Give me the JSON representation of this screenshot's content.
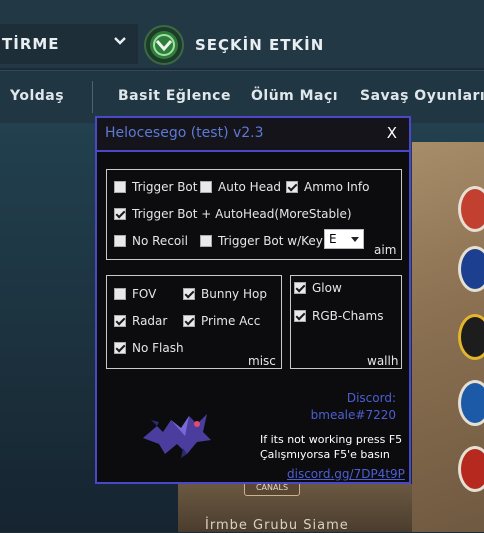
{
  "game": {
    "mode_label": "TİRME",
    "rank_name": "SEÇKİN ETKİN",
    "nav": [
      "Yoldaş",
      "Basit Eğlence",
      "Ölüm Maçı",
      "Savaş Oyunları"
    ],
    "map_tag": "CANALS",
    "bottom_text": "İrmbe Grubu Siame"
  },
  "cheat": {
    "title": "Helocesego (test) v2.3",
    "close": "X",
    "aim_group": {
      "label": "aim",
      "items": [
        {
          "label": "Trigger Bot",
          "checked": false
        },
        {
          "label": "Auto Head",
          "checked": false
        },
        {
          "label": "Ammo Info",
          "checked": true
        },
        {
          "label": "Trigger Bot + AutoHead(MoreStable)",
          "checked": true
        },
        {
          "label": "No Recoil",
          "checked": false
        },
        {
          "label": "Trigger Bot w/Key",
          "checked": false
        }
      ],
      "key_value": "E"
    },
    "misc_group": {
      "label": "misc",
      "items": [
        {
          "label": "FOV",
          "checked": false
        },
        {
          "label": "Bunny Hop",
          "checked": true
        },
        {
          "label": "Radar",
          "checked": true
        },
        {
          "label": "Prime Acc",
          "checked": true
        },
        {
          "label": "No Flash",
          "checked": true
        }
      ]
    },
    "wall_group": {
      "label": "wallh",
      "items": [
        {
          "label": "Glow",
          "checked": true
        },
        {
          "label": "RGB-Chams",
          "checked": true
        }
      ]
    },
    "discord_label": "Discord:",
    "discord_user": "bmeale#7220",
    "hint_en": "If its not working press F5",
    "hint_tr": "Çalışmıyorsa F5'e basın",
    "discord_link": "discord.gg/7DP4t9P"
  },
  "colors": {
    "accent": "#4b47c9",
    "link": "#4d5fd1",
    "panel_bg": "#0c0c0e"
  }
}
